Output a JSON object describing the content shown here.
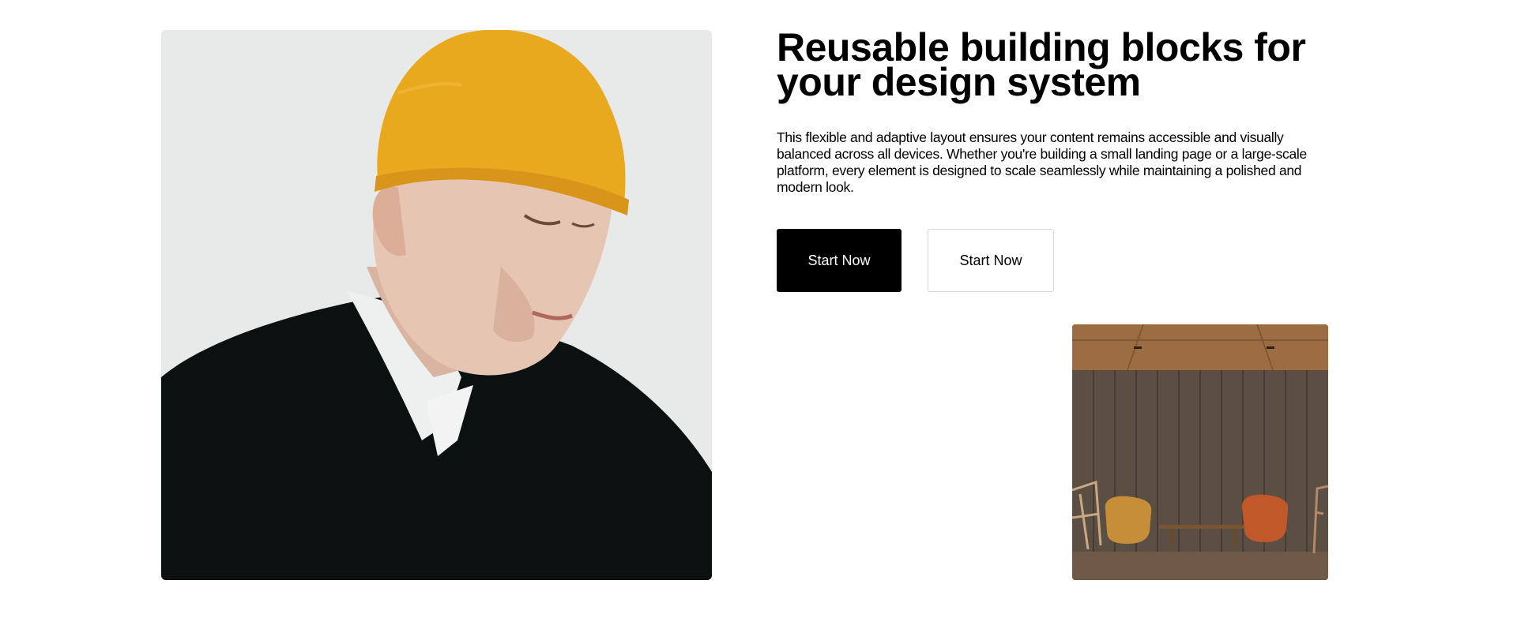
{
  "hero": {
    "image_alt": "Young man wearing a mustard yellow beanie and black sweater over white collared shirt"
  },
  "content": {
    "heading": "Reusable building blocks for your design system",
    "description": "This flexible and adaptive layout ensures your content remains accessible and visually balanced across all devices. Whether you're building a small landing page or a large-scale platform, every element is designed to scale seamlessly while maintaining a polished and modern look."
  },
  "buttons": {
    "primary_label": "Start Now",
    "secondary_label": "Start Now"
  },
  "secondary_image": {
    "image_alt": "Wood-panelled room with orange chairs and a low table"
  },
  "colors": {
    "primary_button_bg": "#000000",
    "primary_button_text": "#ffffff",
    "secondary_button_border": "#d9d9d9",
    "beanie": "#e9a91f"
  }
}
